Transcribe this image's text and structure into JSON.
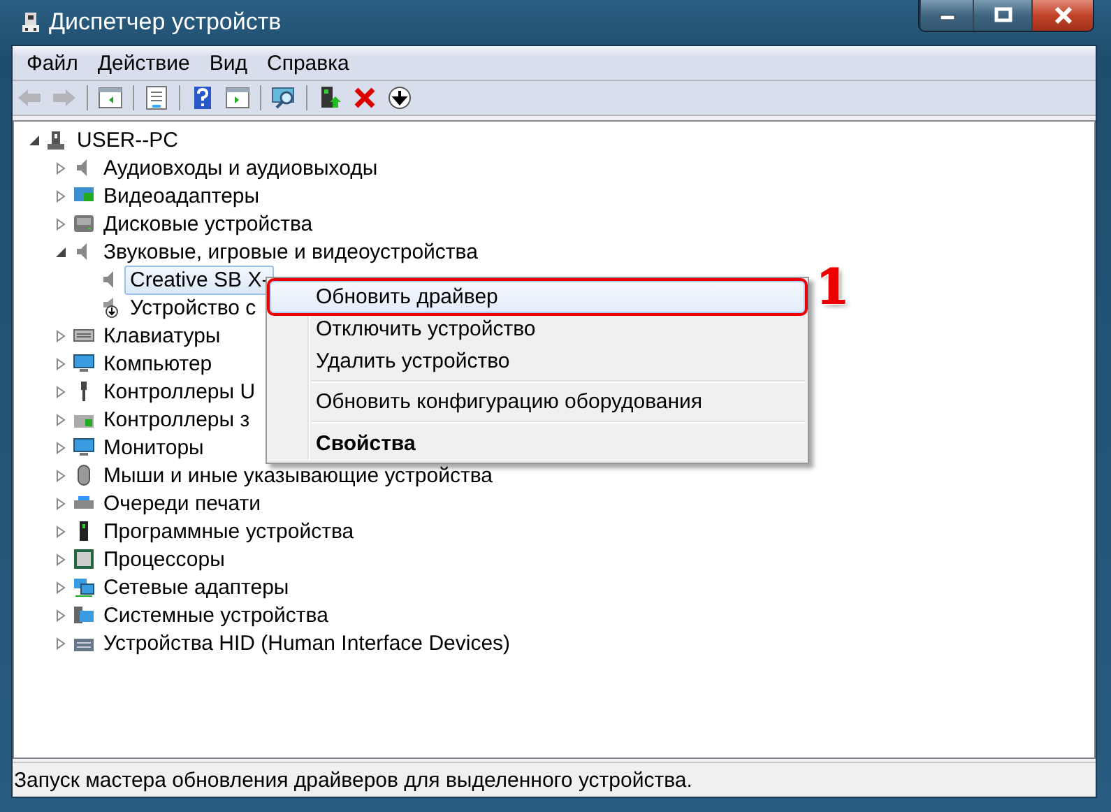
{
  "window": {
    "title": "Диспетчер устройств"
  },
  "menu_bar": [
    "Файл",
    "Действие",
    "Вид",
    "Справка"
  ],
  "toolbar": [
    {
      "kind": "back",
      "disabled": true
    },
    {
      "kind": "forward",
      "disabled": true
    },
    {
      "kind": "sep"
    },
    {
      "kind": "panel",
      "disabled": false
    },
    {
      "kind": "sep"
    },
    {
      "kind": "props",
      "disabled": false
    },
    {
      "kind": "sep"
    },
    {
      "kind": "help",
      "disabled": false
    },
    {
      "kind": "panel2",
      "disabled": false
    },
    {
      "kind": "sep"
    },
    {
      "kind": "scan",
      "disabled": false
    },
    {
      "kind": "sep"
    },
    {
      "kind": "update",
      "disabled": false
    },
    {
      "kind": "remove",
      "disabled": false
    },
    {
      "kind": "down",
      "disabled": false
    }
  ],
  "tree": [
    {
      "label": "USER--PC",
      "expanded": true,
      "selected": false,
      "children": [
        {
          "label": "Аудиовходы и аудиовыходы",
          "expanded": false,
          "selected": false
        },
        {
          "label": "Видеоадаптеры",
          "expanded": false,
          "selected": false
        },
        {
          "label": "Дисковые устройства",
          "expanded": false,
          "selected": false
        },
        {
          "label": "Звуковые, игровые и видеоустройства",
          "expanded": true,
          "selected": false,
          "children": [
            {
              "label": "Creative SB X-",
              "selected": true
            },
            {
              "label": "Устройство с",
              "selected": false
            }
          ]
        },
        {
          "label": "Клавиатуры",
          "expanded": false,
          "selected": false
        },
        {
          "label": "Компьютер",
          "expanded": false,
          "selected": false
        },
        {
          "label": "Контроллеры U",
          "expanded": false,
          "selected": false
        },
        {
          "label": "Контроллеры з",
          "expanded": false,
          "selected": false
        },
        {
          "label": "Мониторы",
          "expanded": false,
          "selected": false
        },
        {
          "label": "Мыши и иные указывающие устройства",
          "expanded": false,
          "selected": false
        },
        {
          "label": "Очереди печати",
          "expanded": false,
          "selected": false
        },
        {
          "label": "Программные устройства",
          "expanded": false,
          "selected": false
        },
        {
          "label": "Процессоры",
          "expanded": false,
          "selected": false
        },
        {
          "label": "Сетевые адаптеры",
          "expanded": false,
          "selected": false
        },
        {
          "label": "Системные устройства",
          "expanded": false,
          "selected": false
        },
        {
          "label": "Устройства HID (Human Interface Devices)",
          "expanded": false,
          "selected": false
        }
      ]
    }
  ],
  "context_menu": [
    {
      "kind": "item",
      "label": "Обновить драйвер",
      "selected": true
    },
    {
      "kind": "item",
      "label": "Отключить устройство",
      "selected": false
    },
    {
      "kind": "item",
      "label": "Удалить устройство",
      "selected": false
    },
    {
      "kind": "separator"
    },
    {
      "kind": "item",
      "label": "Обновить конфигурацию оборудования",
      "selected": false
    },
    {
      "kind": "separator"
    },
    {
      "kind": "default",
      "label": "Свойства",
      "selected": false
    }
  ],
  "annotation": "1",
  "status_bar": "Запуск мастера обновления драйверов для выделенного устройства."
}
